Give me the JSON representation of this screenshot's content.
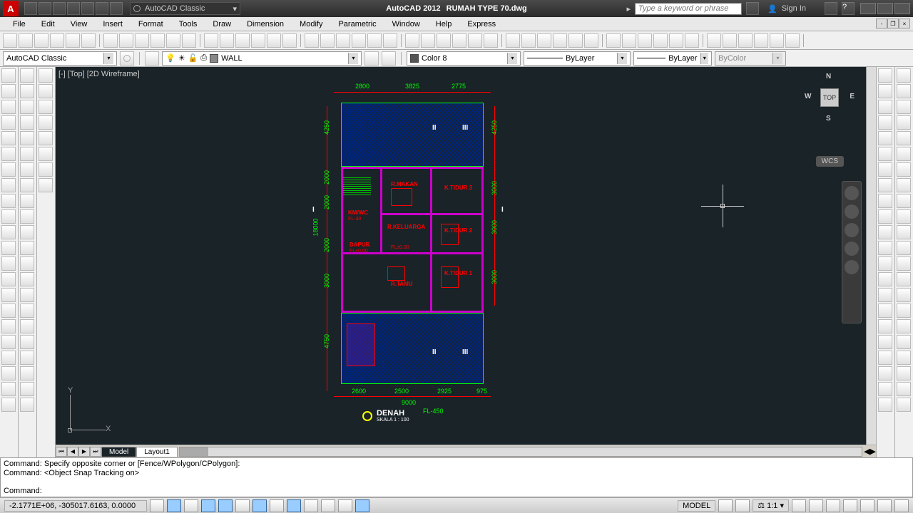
{
  "titlebar": {
    "app_name": "AutoCAD 2012",
    "document": "RUMAH TYPE 70.dwg",
    "workspace": "AutoCAD Classic",
    "search_placeholder": "Type a keyword or phrase",
    "sign_in": "Sign In"
  },
  "menu": [
    "File",
    "Edit",
    "View",
    "Insert",
    "Format",
    "Tools",
    "Draw",
    "Dimension",
    "Modify",
    "Parametric",
    "Window",
    "Help",
    "Express"
  ],
  "property_bar": {
    "workspace": "AutoCAD Classic",
    "layer": "WALL",
    "color": "Color 8",
    "linetype": "ByLayer",
    "lineweight": "ByLayer",
    "plotstyle": "ByColor"
  },
  "viewport": {
    "label": "[-] [Top] [2D Wireframe]",
    "viewcube_face": "TOP",
    "viewcube_dirs": {
      "n": "N",
      "e": "E",
      "s": "S",
      "w": "W"
    },
    "wcs": "WCS",
    "ucs": {
      "x": "X",
      "y": "Y"
    }
  },
  "drawing": {
    "title": "DENAH",
    "scale": "SKALA 1 : 100",
    "floor_level": "FL-450",
    "dims_top": [
      "2800",
      "3825",
      "2775"
    ],
    "dims_left": [
      "4250",
      "2000",
      "2000",
      "2000",
      "3000",
      "4750"
    ],
    "dim_left_total": "18000",
    "dims_right": [
      "4250",
      "3000",
      "3000",
      "3000"
    ],
    "dims_bottom": [
      "2600",
      "2500",
      "2925",
      "975"
    ],
    "dim_bottom_total": "9000",
    "rooms": [
      "R.MAKAN",
      "K.TIDUR 3",
      "R.KELUARGA",
      "K.TIDUR 2",
      "KM/WC",
      "DAPUR",
      "R.TAMU",
      "K.TIDUR 1"
    ],
    "room_fl": [
      "FL-30",
      "FL±0.00",
      "FL±0.00"
    ],
    "section_marks": [
      "I",
      "I",
      "II",
      "II",
      "III",
      "III"
    ]
  },
  "tabs": {
    "model": "Model",
    "layout": "Layout1"
  },
  "command": {
    "prompt": "Command:",
    "line1": "Command: Specify opposite corner or [Fence/WPolygon/CPolygon]:",
    "line2": "Command:  <Object Snap Tracking on>"
  },
  "statusbar": {
    "coords": "-2.1771E+06, -305017.6163, 0.0000",
    "model": "MODEL",
    "scale": "1:1"
  }
}
